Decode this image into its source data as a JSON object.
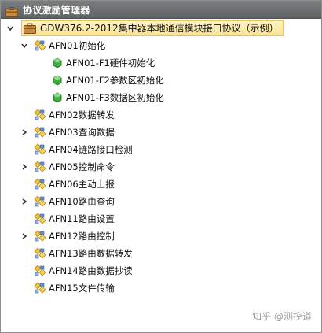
{
  "window": {
    "title": "协议激励管理器"
  },
  "tree": {
    "root": {
      "label": "GDW376.2-2012集中器本地通信模块接口协议（示例）",
      "expanded": true,
      "icon": "folder-box-icon"
    },
    "groups": [
      {
        "label": "AFN01初始化",
        "expanded": true,
        "has_children": true,
        "children": [
          {
            "label": "AFN01-F1硬件初始化"
          },
          {
            "label": "AFN01-F2参数区初始化"
          },
          {
            "label": "AFN01-F3数据区初始化"
          }
        ]
      },
      {
        "label": "AFN02数据转发",
        "has_children": false
      },
      {
        "label": "AFN03查询数据",
        "has_children": true,
        "expanded": false
      },
      {
        "label": "AFN04链路接口检测",
        "has_children": false
      },
      {
        "label": "AFN05控制命令",
        "has_children": true,
        "expanded": false
      },
      {
        "label": "AFN06主动上报",
        "has_children": false
      },
      {
        "label": "AFN10路由查询",
        "has_children": true,
        "expanded": false
      },
      {
        "label": "AFN11路由设置",
        "has_children": false
      },
      {
        "label": "AFN12路由控制",
        "has_children": true,
        "expanded": false
      },
      {
        "label": "AFN13路由数据转发",
        "has_children": false
      },
      {
        "label": "AFN14路由数据抄读",
        "has_children": false
      },
      {
        "label": "AFN15文件传输",
        "has_children": false
      }
    ]
  },
  "watermark": "知乎 @测控道",
  "colors": {
    "titlebar": "#6d6f71",
    "selection": "#fbe392",
    "leaf_icon": "#3fae3f",
    "group_icon_diamond": "#f2c230",
    "group_icon_blue": "#6a8fd6"
  }
}
